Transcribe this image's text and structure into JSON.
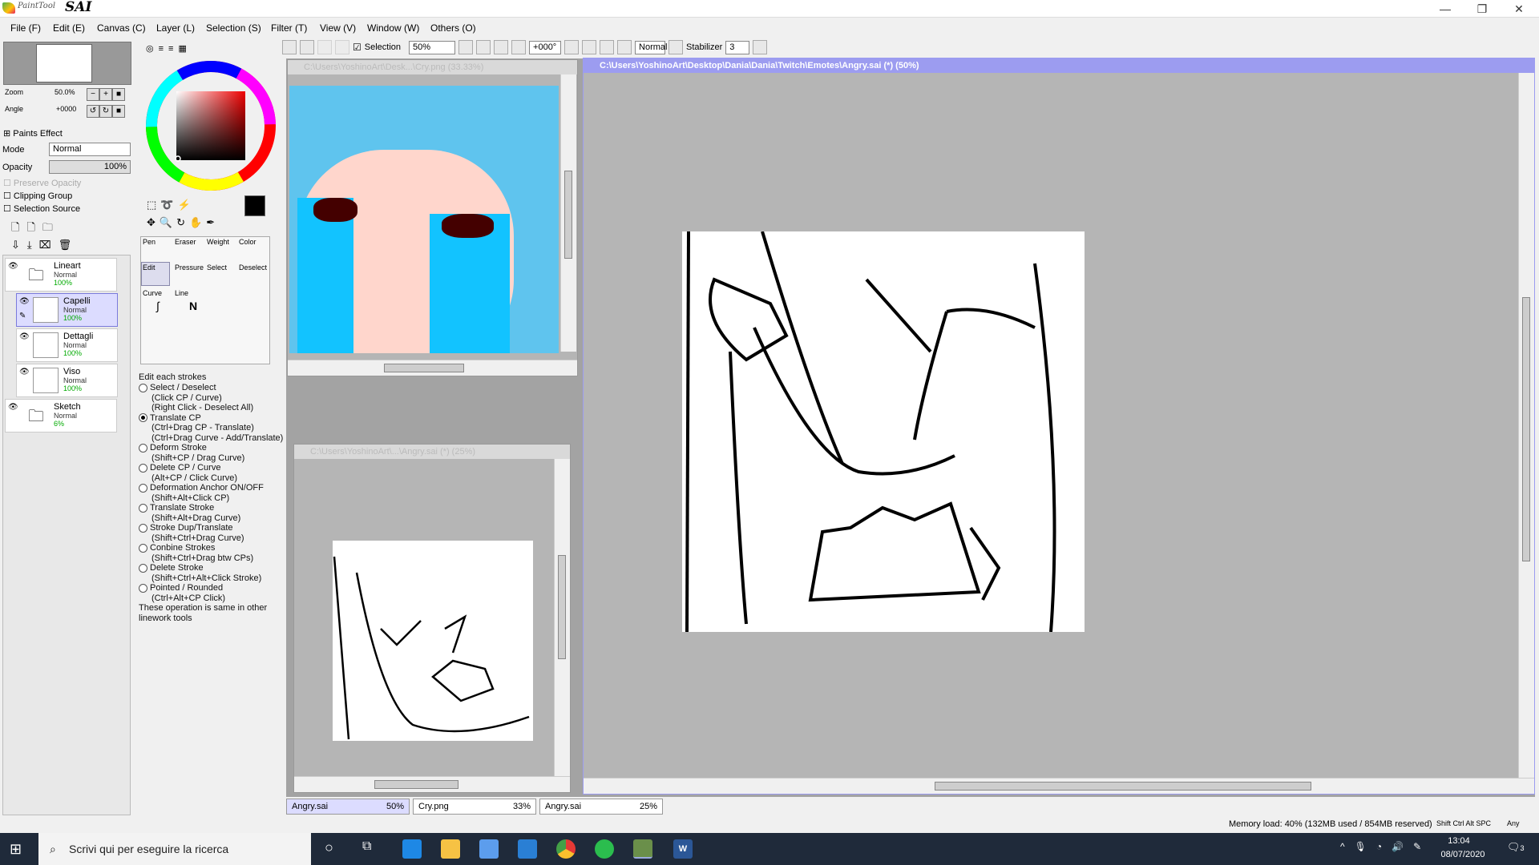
{
  "app": {
    "logo_small": "PaintTool",
    "logo_big": "SAI"
  },
  "window_controls": {
    "minimize": "—",
    "restore": "❐",
    "close": "✕"
  },
  "menu": [
    "File (F)",
    "Edit (E)",
    "Canvas (C)",
    "Layer (L)",
    "Selection (S)",
    "Filter (T)",
    "View (V)",
    "Window (W)",
    "Others (O)"
  ],
  "toolbar": {
    "selection_label": "Selection",
    "zoom": "50%",
    "angle": "+000°",
    "blend": "Normal",
    "stabilizer_label": "Stabilizer",
    "stabilizer": "3"
  },
  "navigator": {
    "zoom_label": "Zoom",
    "zoom": "50.0%",
    "angle_label": "Angle",
    "angle": "+0000"
  },
  "layer_props": {
    "paints_effect": "Paints Effect",
    "mode_label": "Mode",
    "mode": "Normal",
    "opacity_label": "Opacity",
    "opacity": "100%",
    "preserve": "Preserve Opacity",
    "clipping": "Clipping Group",
    "selsource": "Selection Source"
  },
  "layers": [
    {
      "name": "Lineart",
      "mode": "Normal",
      "pct": "100%"
    },
    {
      "name": "Capelli",
      "mode": "Normal",
      "pct": "100%"
    },
    {
      "name": "Dettagli",
      "mode": "Normal",
      "pct": "100%"
    },
    {
      "name": "Viso",
      "mode": "Normal",
      "pct": "100%"
    },
    {
      "name": "Sketch",
      "mode": "Normal",
      "pct": "6%"
    }
  ],
  "tools": {
    "pen": "Pen",
    "eraser": "Eraser",
    "weight": "Weight",
    "color": "Color",
    "edit": "Edit",
    "pressure": "Pressure",
    "select": "Select",
    "deselect": "Deselect",
    "curve": "Curve",
    "line": "Line"
  },
  "edit_options": {
    "header": "Edit each strokes",
    "items": [
      {
        "label": "Select / Deselect",
        "subs": [
          "(Click CP / Curve)",
          "(Right Click - Deselect All)"
        ],
        "on": false
      },
      {
        "label": "Translate CP",
        "subs": [
          "(Ctrl+Drag CP - Translate)",
          "(Ctrl+Drag Curve - Add/Translate)"
        ],
        "on": true
      },
      {
        "label": "Deform Stroke",
        "subs": [
          "(Shift+CP / Drag Curve)"
        ],
        "on": false
      },
      {
        "label": "Delete CP / Curve",
        "subs": [
          "(Alt+CP / Click Curve)"
        ],
        "on": false
      },
      {
        "label": "Deformation Anchor ON/OFF",
        "subs": [
          "(Shift+Alt+Click CP)"
        ],
        "on": false
      },
      {
        "label": "Translate Stroke",
        "subs": [
          "(Shift+Alt+Drag Curve)"
        ],
        "on": false
      },
      {
        "label": "Stroke Dup/Translate",
        "subs": [
          "(Shift+Ctrl+Drag Curve)"
        ],
        "on": false
      },
      {
        "label": "Conbine Strokes",
        "subs": [
          "(Shift+Ctrl+Drag btw CPs)"
        ],
        "on": false
      },
      {
        "label": "Delete Stroke",
        "subs": [
          "(Shift+Ctrl+Alt+Click Stroke)"
        ],
        "on": false
      },
      {
        "label": "Pointed / Rounded",
        "subs": [
          "(Ctrl+Alt+CP Click)"
        ],
        "on": false
      }
    ],
    "footer1": "These operation is same in other",
    "footer2": "linework tools"
  },
  "windows": {
    "cry_title": "C:\\Users\\YoshinoArt\\Desk...\\Cry.png (33.33%)",
    "angry_small_title": "C:\\Users\\YoshinoArt\\...\\Angry.sai (*) (25%)",
    "angry_main_title": "C:\\Users\\YoshinoArt\\Desktop\\Dania\\Dania\\Twitch\\Emotes\\Angry.sai (*) (50%)"
  },
  "doc_tabs": [
    {
      "name": "Angry.sai",
      "zoom": "50%"
    },
    {
      "name": "Cry.png",
      "zoom": "33%"
    },
    {
      "name": "Angry.sai",
      "zoom": "25%"
    }
  ],
  "status": {
    "memory": "Memory load: 40% (132MB used / 854MB reserved)",
    "keys": "Shift Ctrl Alt SPC",
    "any": "Any"
  },
  "taskbar": {
    "search_placeholder": "Scrivi qui per eseguire la ricerca",
    "time": "13:04",
    "date": "08/07/2020",
    "notif": "3"
  }
}
